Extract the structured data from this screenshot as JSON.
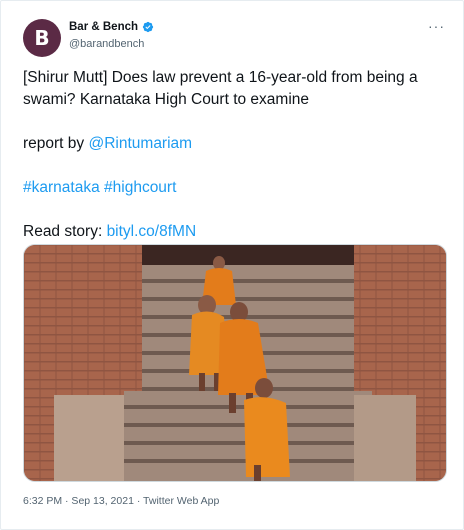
{
  "author": {
    "display_name": "Bar & Bench",
    "handle": "@barandbench",
    "avatar_letter": "B",
    "verified": true
  },
  "menu": {
    "more_glyph": "···"
  },
  "tweet": {
    "line1": "[Shirur Mutt] Does law prevent a 16-year-old from being a swami? Karnataka High Court to examine",
    "report_prefix": "report by ",
    "report_mention": "@Rintumariam",
    "hashtag1": "#karnataka",
    "hashtag2": "#highcourt",
    "read_prefix": "Read story: ",
    "read_link": "bityl.co/8fMN"
  },
  "media": {
    "icon": "photo-icon"
  },
  "meta": {
    "timestamp": "6:32 PM · Sep 13, 2021 · Twitter Web App"
  },
  "colors": {
    "link": "#1d9bf0",
    "verified": "#1d9bf0",
    "avatar_bg": "#5b2a45",
    "robe": "#e37c1b"
  }
}
